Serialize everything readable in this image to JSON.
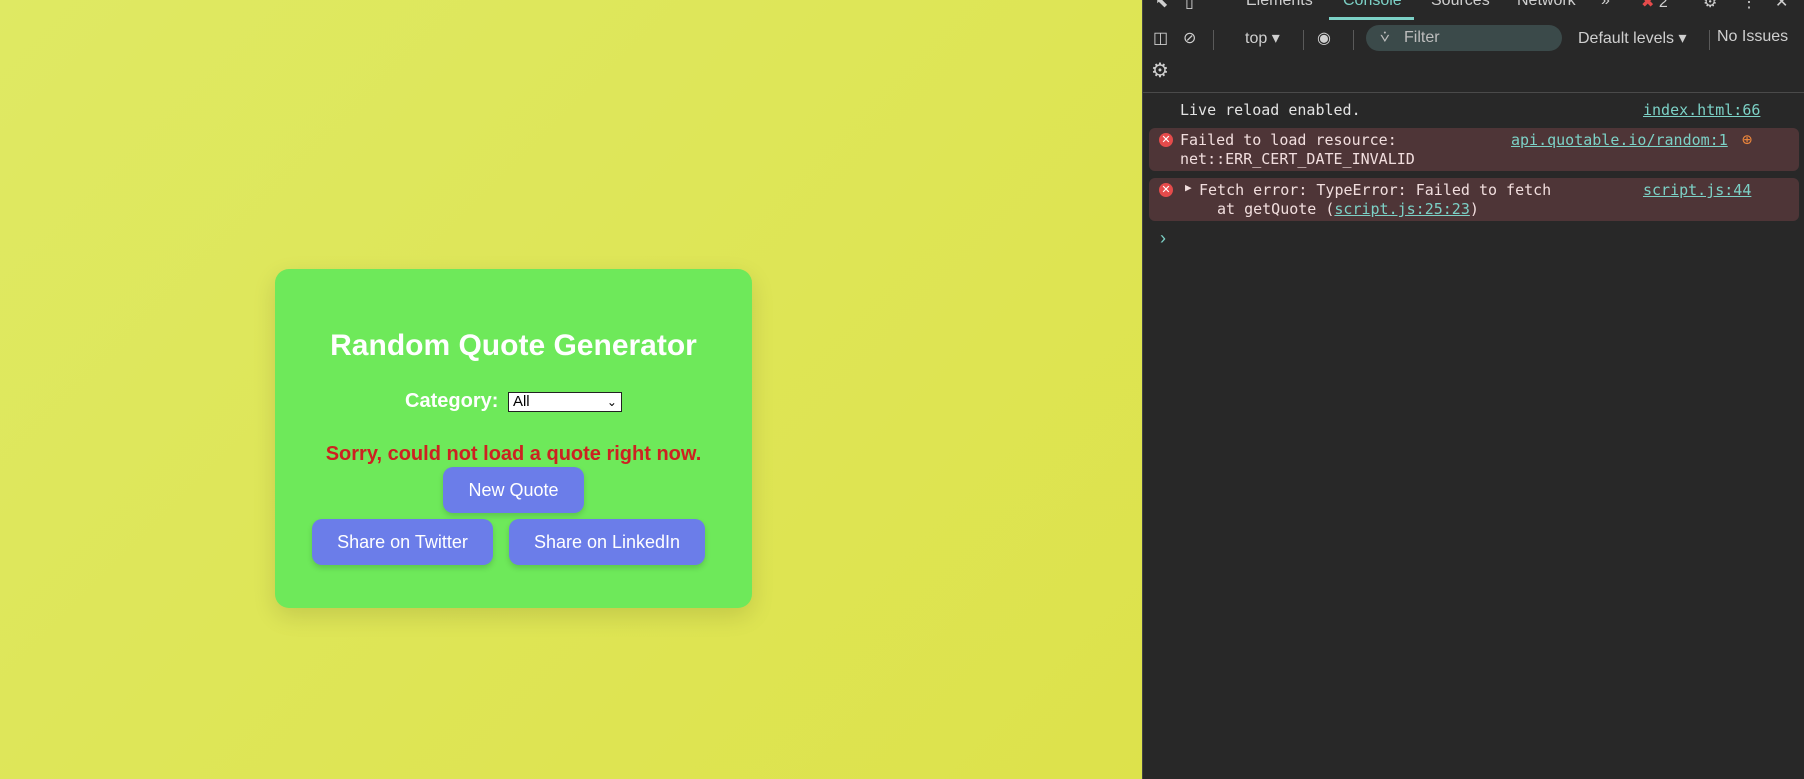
{
  "page": {
    "card": {
      "title": "Random Quote Generator",
      "category_label": "Category:",
      "category_selected": "All",
      "error_message": "Sorry, could not load a quote right now.",
      "new_quote_label": "New Quote",
      "share_twitter_label": "Share on Twitter",
      "share_linkedin_label": "Share on LinkedIn"
    },
    "colors": {
      "background": "#dfe963",
      "card": "#6ee95a",
      "button": "#6b7de9",
      "error_text": "#cd2121"
    }
  },
  "devtools": {
    "tabs": [
      "Elements",
      "Console",
      "Sources",
      "Network"
    ],
    "active_tab": "Console",
    "error_count": "2",
    "toolbar": {
      "context": "top",
      "filter_placeholder": "Filter",
      "levels": "Default levels",
      "issues": "No Issues"
    },
    "logs": [
      {
        "type": "info",
        "message": "Live reload enabled.",
        "source": "index.html:66"
      },
      {
        "type": "error",
        "message_line1": "Failed to load resource:",
        "message_line2": "net::ERR_CERT_DATE_INVALID",
        "source": "api.quotable.io/random:1"
      },
      {
        "type": "error",
        "message_line1": "Fetch error: TypeError: Failed to fetch",
        "message_line2_prefix": "at getQuote (",
        "message_line2_link": "script.js:25:23",
        "message_line2_suffix": ")",
        "source": "script.js:44"
      }
    ],
    "colors": {
      "panel": "#282828",
      "accent": "#7cd1c6",
      "error_row": "#4e3537",
      "error_icon": "#e54b4b"
    }
  }
}
